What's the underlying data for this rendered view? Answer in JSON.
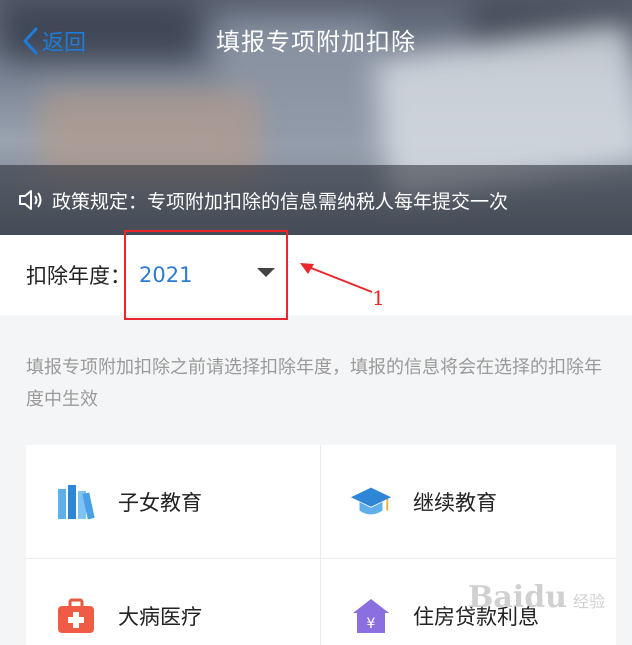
{
  "header": {
    "back_label": "返回",
    "title": "填报专项附加扣除"
  },
  "notice": {
    "text": "政策规定：专项附加扣除的信息需纳税人每年提交一次"
  },
  "year_selector": {
    "label": "扣除年度：",
    "value": "2021"
  },
  "annotation": {
    "number": "1",
    "color": "#e8262b"
  },
  "hint": {
    "text": "填报专项附加扣除之前请选择扣除年度，填报的信息将会在选择的扣除年度中生效"
  },
  "deductions": [
    {
      "label": "子女教育",
      "icon": "books-icon"
    },
    {
      "label": "继续教育",
      "icon": "graduation-cap-icon"
    },
    {
      "label": "大病医疗",
      "icon": "medical-kit-icon"
    },
    {
      "label": "住房贷款利息",
      "icon": "house-yen-icon"
    }
  ],
  "watermark": {
    "text": "Baidu",
    "sub": "经验"
  },
  "colors": {
    "accent": "#2f7bd3",
    "back": "#1f7bd8",
    "annotation": "#e8262b"
  }
}
